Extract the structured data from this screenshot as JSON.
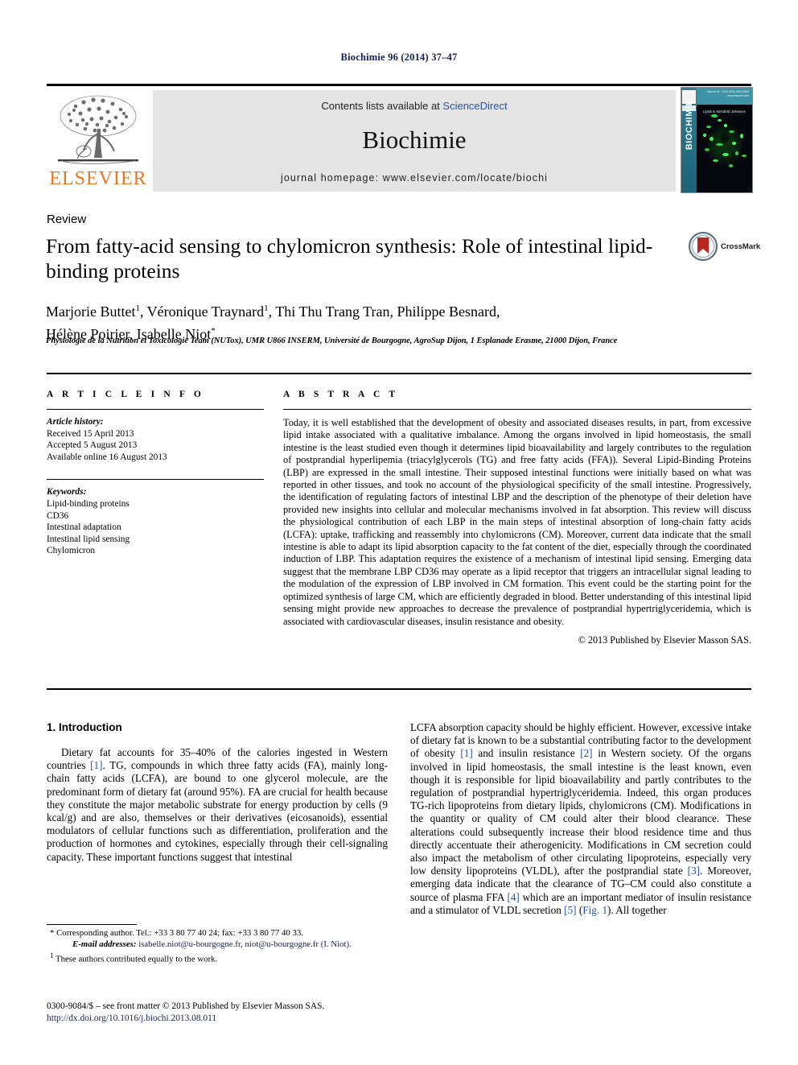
{
  "running_head": "Biochimie 96 (2014) 37–47",
  "banner": {
    "contents_prefix": "Contents lists available at ",
    "sciencedirect": "ScienceDirect",
    "journal_name": "Biochimie",
    "homepage": "journal homepage: www.elsevier.com/locate/biochi",
    "publisher_logo_text": "ELSEVIER",
    "cover_spine_text": "BIOCHIMIE",
    "cover_caption": "Lipids in Metabolic Diseases",
    "cover_top_text": "Volume 96 . 2014\nISSN 0300-9084\nwww.elsevier.com"
  },
  "article": {
    "type_label": "Review",
    "title": "From fatty-acid sensing to chylomicron synthesis: Role of intestinal lipid-binding proteins",
    "crossmark_label": "CrossMark",
    "authors": "Marjorie Buttet 1, Véronique Traynard 1, Thi Thu Trang Tran, Philippe Besnard, Hélène Poirier, Isabelle Niot*",
    "affiliation": "Physiologie de la Nutrition et Toxicologie Team (NUTox), UMR U866 INSERM, Université de Bourgogne, AgroSup Dijon, 1 Esplanade Erasme, 21000 Dijon, France"
  },
  "info": {
    "heading": "A R T I C L E  I N F O",
    "history_label": "Article history:",
    "history": [
      "Received 15 April 2013",
      "Accepted 5 August 2013",
      "Available online 16 August 2013"
    ],
    "keywords_label": "Keywords:",
    "keywords": [
      "Lipid-binding proteins",
      "CD36",
      "Intestinal adaptation",
      "Intestinal lipid sensing",
      "Chylomicron"
    ]
  },
  "abstract": {
    "heading": "A B S T R A C T",
    "text": "Today, it is well established that the development of obesity and associated diseases results, in part, from excessive lipid intake associated with a qualitative imbalance. Among the organs involved in lipid homeostasis, the small intestine is the least studied even though it determines lipid bioavailability and largely contributes to the regulation of postprandial hyperlipemia (triacylglycerols (TG) and free fatty acids (FFA)). Several Lipid-Binding Proteins (LBP) are expressed in the small intestine. Their supposed intestinal functions were initially based on what was reported in other tissues, and took no account of the physiological specificity of the small intestine. Progressively, the identification of regulating factors of intestinal LBP and the description of the phenotype of their deletion have provided new insights into cellular and molecular mechanisms involved in fat absorption. This review will discuss the physiological contribution of each LBP in the main steps of intestinal absorption of long-chain fatty acids (LCFA): uptake, trafficking and reassembly into chylomicrons (CM). Moreover, current data indicate that the small intestine is able to adapt its lipid absorption capacity to the fat content of the diet, especially through the coordinated induction of LBP. This adaptation requires the existence of a mechanism of intestinal lipid sensing. Emerging data suggest that the membrane LBP CD36 may operate as a lipid receptor that triggers an intracellular signal leading to the modulation of the expression of LBP involved in CM formation. This event could be the starting point for the optimized synthesis of large CM, which are efficiently degraded in blood. Better understanding of this intestinal lipid sensing might provide new approaches to decrease the prevalence of postprandial hypertriglyceridemia, which is associated with cardiovascular diseases, insulin resistance and obesity.",
    "copyright": "© 2013 Published by Elsevier Masson SAS."
  },
  "body": {
    "section_heading": "1.  Introduction",
    "left_paragraph_part1": "Dietary fat accounts for 35–40% of the calories ingested in Western countries ",
    "left_ref1": "[1]",
    "left_paragraph_part2": ". TG, compounds in which three fatty acids (FA), mainly long-chain fatty acids (LCFA), are bound to one glycerol molecule, are the predominant form of dietary fat (around 95%). FA are crucial for health because they constitute the major metabolic substrate for energy production by cells (9 kcal/g) and are also, themselves or their derivatives (eicosanoids), essential modulators of cellular functions such as differentiation, proliferation and the production of hormones and cytokines, especially through their cell-signaling capacity. These important functions suggest that intestinal",
    "right_part1": "LCFA absorption capacity should be highly efficient. However, excessive intake of dietary fat is known to be a substantial contributing factor to the development of obesity ",
    "right_ref1": "[1]",
    "right_part2": " and insulin resistance ",
    "right_ref2": "[2]",
    "right_part3": " in Western society. Of the organs involved in lipid homeostasis, the small intestine is the least known, even though it is responsible for lipid bioavailability and partly contributes to the regulation of postprandial hypertriglyceridemia. Indeed, this organ produces TG-rich lipoproteins from dietary lipids, chylomicrons (CM). Modifications in the quantity or quality of CM could alter their blood clearance. These alterations could subsequently increase their blood residence time and thus directly accentuate their atherogenicity. Modifications in CM secretion could also impact the metabolism of other circulating lipoproteins, especially very low density lipoproteins (VLDL), after the postprandial state ",
    "right_ref3": "[3]",
    "right_part4": ". Moreover, emerging data indicate that the clearance of TG–CM could also constitute a source of plasma FFA ",
    "right_ref4": "[4]",
    "right_part5": " which are an important mediator of insulin resistance and a stimulator of VLDL secretion ",
    "right_ref5": "[5]",
    "right_part6": " (",
    "right_figref": "Fig. 1",
    "right_part7": "). All together"
  },
  "footnotes": {
    "corresponding_mark": "*",
    "corresponding_text": "Corresponding author. Tel.: +33 3 80 77 40 24; fax: +33 3 80 77 40 33.",
    "email_label": "E-mail addresses:",
    "email_text": "isabelle.niot@u-bourgogne.fr, niot@u-bourgogne.fr (I. Niot).",
    "equal_mark": "1",
    "equal_text": "These authors contributed equally to the work.",
    "issn_line": "0300-9084/$ – see front matter © 2013 Published by Elsevier Masson SAS.",
    "doi_line": "http://dx.doi.org/10.1016/j.biochi.2013.08.011"
  },
  "colors": {
    "link_blue": "#2a53a8",
    "runhead_navy": "#16205c",
    "elsevier_orange": "#e87722",
    "banner_grey": "#e4e4e4",
    "cover_teal": "#2f7f93",
    "crossmark_red": "#b5271f"
  }
}
